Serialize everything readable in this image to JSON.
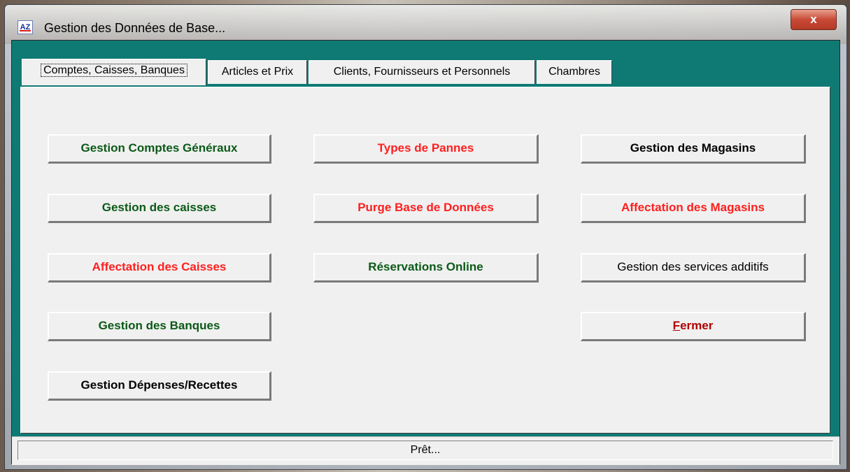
{
  "window": {
    "title": "Gestion des Données de Base...",
    "close_label": "x"
  },
  "app_icon": {
    "glyph": "AZ"
  },
  "tabs": [
    {
      "label": "Comptes, Caisses, Banques",
      "active": true
    },
    {
      "label": "Articles et Prix"
    },
    {
      "label": "Clients, Fournisseurs et Personnels"
    },
    {
      "label": "Chambres"
    }
  ],
  "buttons": {
    "gestion_comptes_generaux": "Gestion Comptes Généraux",
    "types_de_pannes": "Types de Pannes",
    "gestion_des_magasins": "Gestion des Magasins",
    "gestion_des_caisses": "Gestion des caisses",
    "purge_base_de_donnees": "Purge Base de Données",
    "affectation_des_magasins": "Affectation des Magasins",
    "affectation_des_caisses": "Affectation des Caisses",
    "reservations_online": "Réservations Online",
    "gestion_des_services_additifs": "Gestion des services additifs",
    "gestion_des_banques": "Gestion des Banques",
    "fermer_accel": "F",
    "fermer_rest": "ermer",
    "gestion_depenses_recettes": "Gestion Dépenses/Recettes"
  },
  "status": {
    "text": "Prêt..."
  },
  "colors": {
    "teal_frame": "#0f7a74",
    "green_text": "#0b5a17",
    "red_text": "#ff1f1f",
    "close_red": "#c84a36"
  }
}
